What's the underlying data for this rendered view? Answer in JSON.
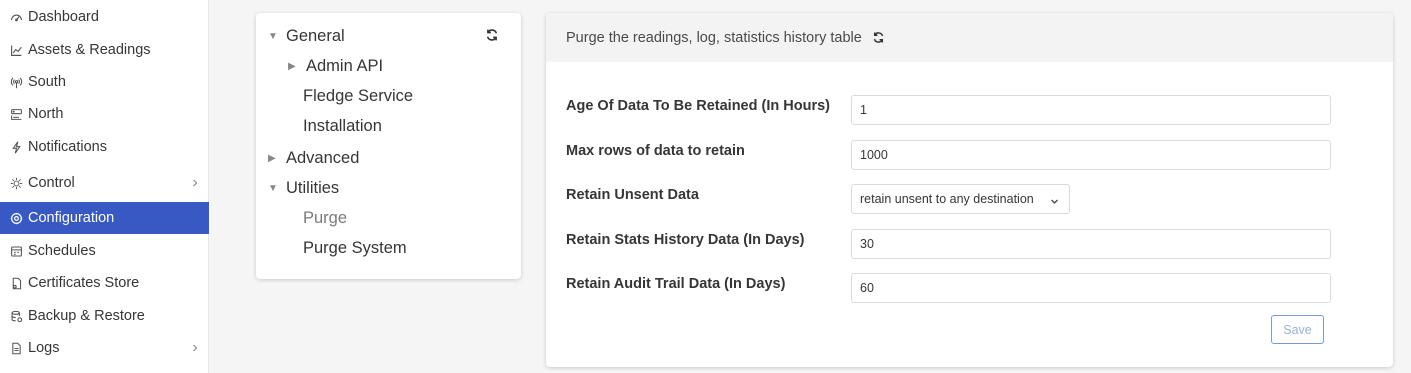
{
  "sidebar": {
    "items": [
      {
        "label": "Dashboard",
        "icon": "dashboard-icon"
      },
      {
        "label": "Assets & Readings",
        "icon": "chart-line-icon"
      },
      {
        "label": "South",
        "icon": "broadcast-icon"
      },
      {
        "label": "North",
        "icon": "server-icon"
      },
      {
        "label": "Notifications",
        "icon": "lightning-icon"
      },
      {
        "label": "Control",
        "icon": "sun-cog-icon",
        "has_children": true
      },
      {
        "label": "Configuration",
        "icon": "gear-icon",
        "active": true
      },
      {
        "label": "Schedules",
        "icon": "calendar-icon"
      },
      {
        "label": "Certificates Store",
        "icon": "certificate-icon"
      },
      {
        "label": "Backup & Restore",
        "icon": "database-icon"
      },
      {
        "label": "Logs",
        "icon": "file-icon",
        "has_children": true
      }
    ],
    "active_color": "#3858c4"
  },
  "tree": {
    "items": [
      {
        "label": "General",
        "expander": "▼"
      },
      {
        "label": "Admin API",
        "expander": "▶"
      },
      {
        "label": "Fledge Service",
        "expander": ""
      },
      {
        "label": "Installation",
        "expander": ""
      },
      {
        "label": "Advanced",
        "expander": "▶"
      },
      {
        "label": "Utilities",
        "expander": "▼"
      },
      {
        "label": "Purge",
        "expander": "",
        "selected": true
      },
      {
        "label": "Purge System",
        "expander": ""
      }
    ]
  },
  "form": {
    "title": "Purge the readings, log, statistics history table",
    "fields": [
      {
        "label": "Age Of Data To Be Retained (In Hours)",
        "value": "1"
      },
      {
        "label": "Max rows of data to retain",
        "value": "1000"
      },
      {
        "label": "Retain Unsent Data",
        "value": "retain unsent to any destination"
      },
      {
        "label": "Retain Stats History Data (In Days)",
        "value": "30"
      },
      {
        "label": "Retain Audit Trail Data (In Days)",
        "value": "60"
      }
    ],
    "save_label": "Save"
  }
}
